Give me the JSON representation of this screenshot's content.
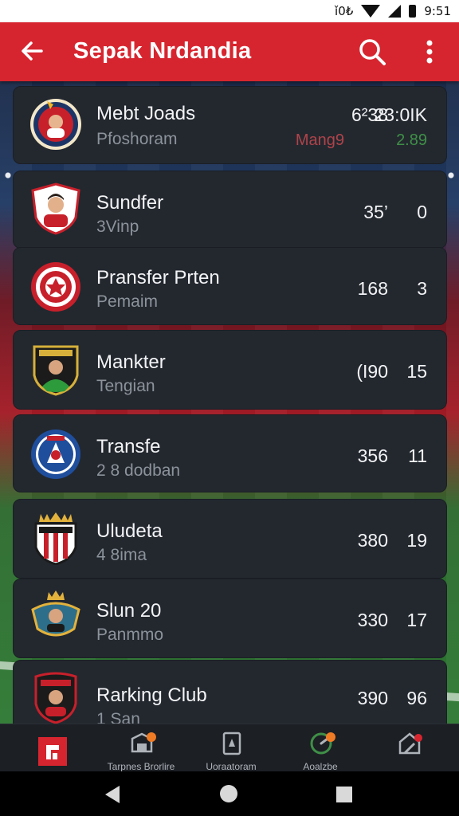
{
  "status_bar": {
    "left_text": "ǐ0₺",
    "time": "9:51"
  },
  "app_bar": {
    "title": "Sepak Nrdandia",
    "back_icon": "arrow-left-icon",
    "search_icon": "search-icon",
    "more_icon": "more-vertical-icon"
  },
  "clubs": [
    {
      "name": "Mebt Joads",
      "sub": "Pfoshoram",
      "v1": "6²38",
      "v2": "23:0IK",
      "sub_v1": "Mang9",
      "sub_v2": "2.89",
      "badge_color": "#c7202b"
    },
    {
      "name": "Sundfer",
      "sub": "3Vinp",
      "v1": "35’",
      "v2": "0",
      "badge_color": "#c7202b"
    },
    {
      "name": "Pransfer Prten",
      "sub": "Pemaim",
      "v1": "168",
      "v2": "3",
      "badge_color": "#c7202b"
    },
    {
      "name": "Mankter",
      "sub": "Tengian",
      "v1": "(I90",
      "v2": "15",
      "badge_color": "#2d7a2d"
    },
    {
      "name": "Transfe",
      "sub": "2 8 dodban",
      "v1": "356",
      "v2": "11",
      "badge_color": "#1f4e9c"
    },
    {
      "name": "Uludeta",
      "sub": "4 8ima",
      "v1": "380",
      "v2": "19",
      "badge_color": "#c7202b"
    },
    {
      "name": "Slun 20",
      "sub": "Panmmo",
      "v1": "330",
      "v2": "17",
      "badge_color": "#2d6f8a"
    },
    {
      "name": "Rarking Club",
      "sub": "1 San",
      "v1": "390",
      "v2": "96",
      "badge_color": "#c7202b"
    }
  ],
  "bottom_nav": [
    {
      "label": "",
      "icon": "club-home-icon"
    },
    {
      "label": "Tarpnes Brorlire",
      "icon": "briefcase-icon"
    },
    {
      "label": "Uoraatoram",
      "icon": "card-icon"
    },
    {
      "label": "Aoalzbe",
      "icon": "gauge-icon"
    },
    {
      "label": "",
      "icon": "stadium-icon"
    }
  ],
  "colors": {
    "primary": "#d7252f",
    "card_bg": "#23282f",
    "accent_orange": "#f07b25",
    "sub_red": "#b0434a",
    "sub_green": "#3f8f47"
  }
}
